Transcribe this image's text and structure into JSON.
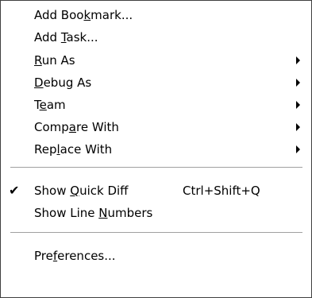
{
  "menu": {
    "items": [
      {
        "label_pre": "Add Boo",
        "label_u": "k",
        "label_post": "mark..."
      },
      {
        "label_pre": "Add ",
        "label_u": "T",
        "label_post": "ask..."
      },
      {
        "label_pre": "",
        "label_u": "R",
        "label_post": "un As"
      },
      {
        "label_pre": "",
        "label_u": "D",
        "label_post": "ebug As"
      },
      {
        "label_pre": "T",
        "label_u": "e",
        "label_post": "am"
      },
      {
        "label_pre": "Comp",
        "label_u": "a",
        "label_post": "re With"
      },
      {
        "label_pre": "Rep",
        "label_u": "l",
        "label_post": "ace With"
      },
      {
        "label_pre": "Show ",
        "label_u": "Q",
        "label_post": "uick Diff",
        "check": "✔",
        "shortcut": "Ctrl+Shift+Q"
      },
      {
        "label_pre": "Show Line ",
        "label_u": "N",
        "label_post": "umbers"
      },
      {
        "label_pre": "Pre",
        "label_u": "f",
        "label_post": "erences..."
      }
    ]
  },
  "icons": {
    "submenu": "submenu-arrow-icon",
    "check": "checkmark-icon"
  },
  "colors": {
    "background": "#ffffff",
    "text": "#000000",
    "border": "#404040",
    "separator": "#a0a0a0"
  }
}
